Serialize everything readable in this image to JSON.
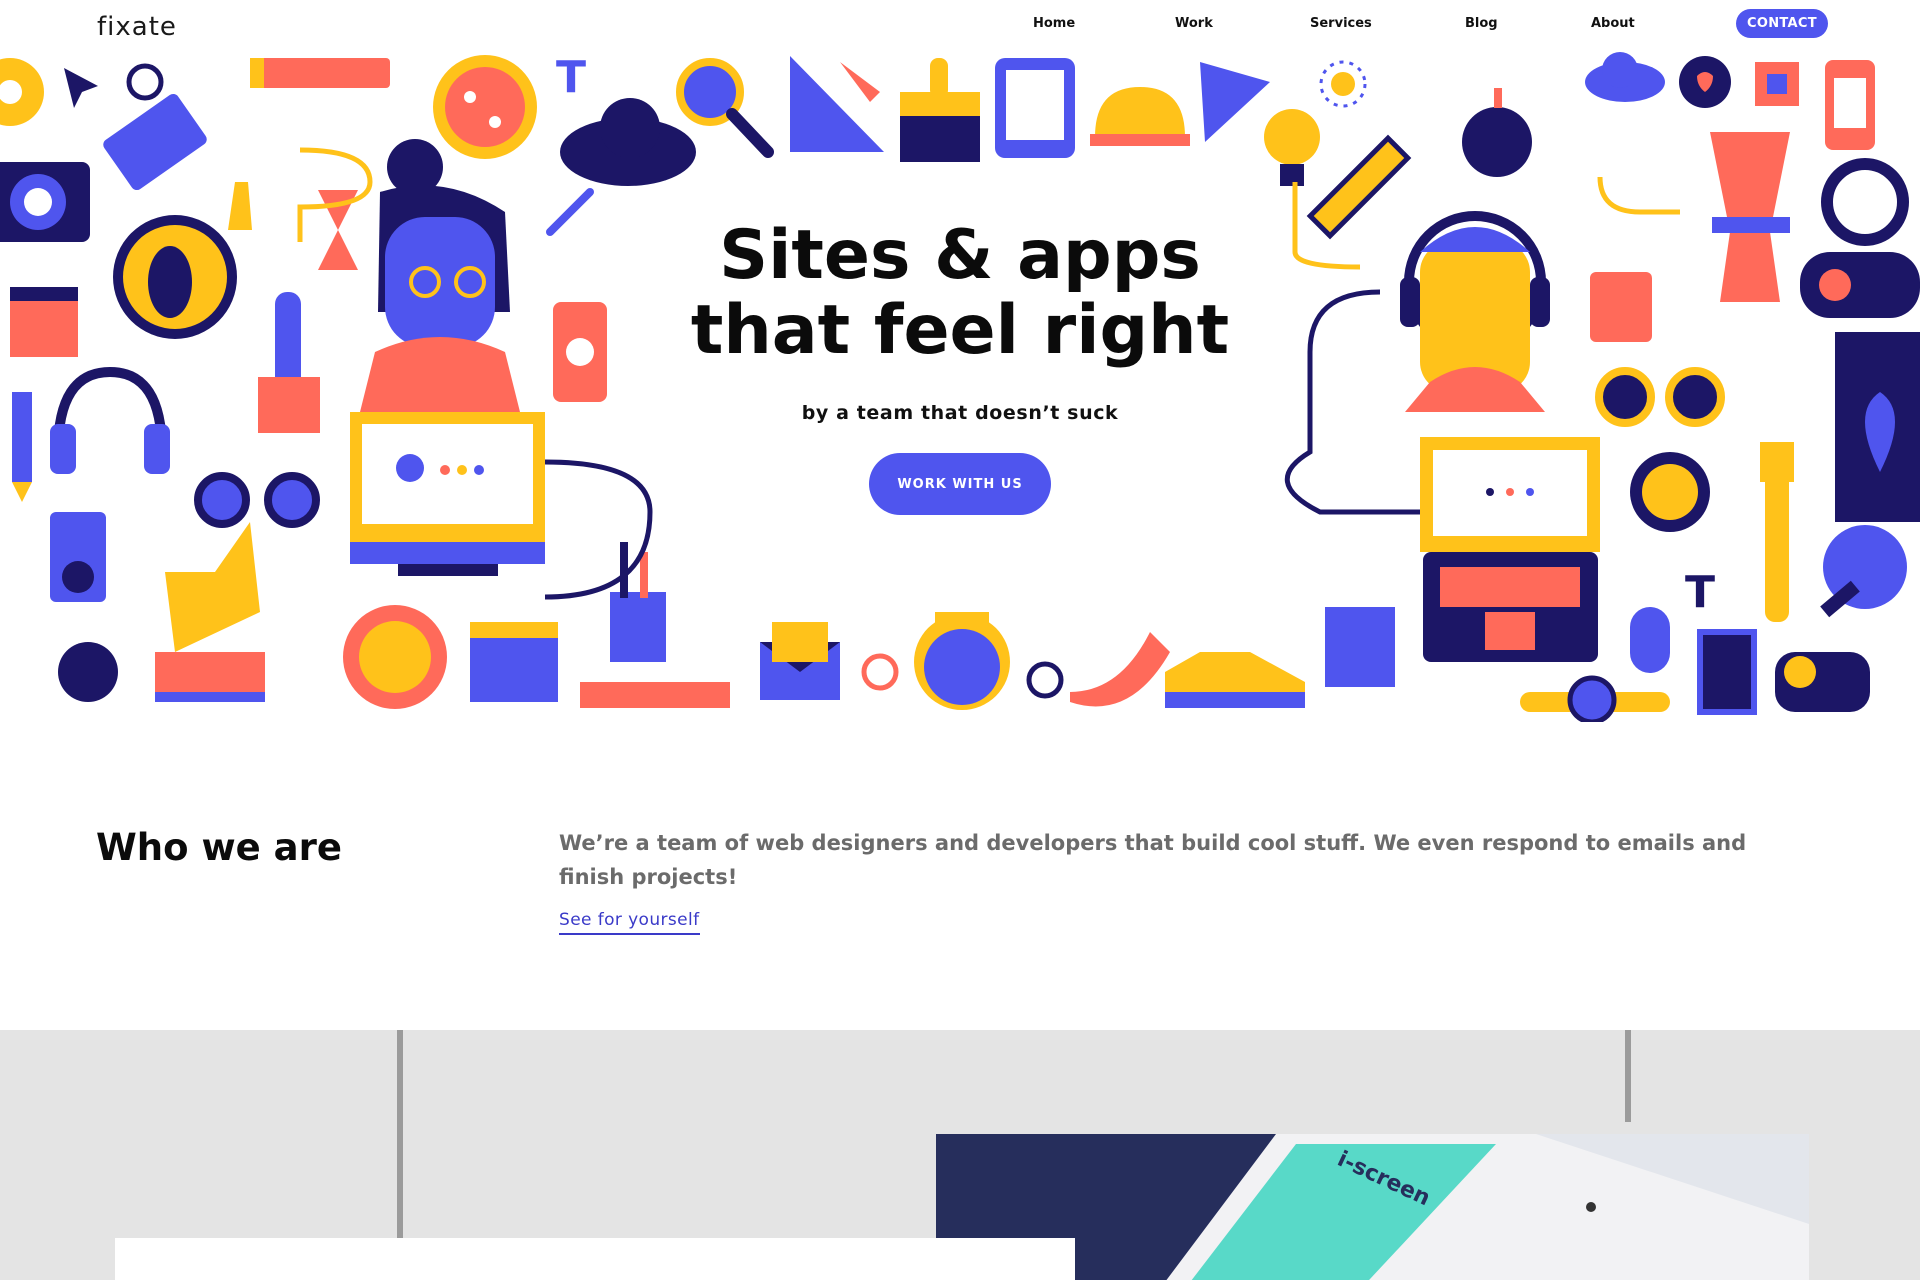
{
  "brand": {
    "logo": "fixate"
  },
  "nav": {
    "items": [
      "Home",
      "Work",
      "Services",
      "Blog",
      "About"
    ],
    "contact": "CONTACT"
  },
  "hero": {
    "headline_line1": "Sites & apps",
    "headline_line2": "that feel right",
    "subheading": "by a team that doesn’t suck",
    "cta": "WORK WITH US"
  },
  "about": {
    "title": "Who we are",
    "text": "We’re a team of web designers and developers that build cool stuff. We even respond to emails and finish projects!",
    "link": "See for yourself"
  },
  "case_study": {
    "brand_text": "i-screen"
  },
  "colors": {
    "accent": "#4f55ee",
    "navy": "#1c1666",
    "yellow": "#ffc21a",
    "coral": "#ff6a5a",
    "gray": "#e4e4e4"
  }
}
